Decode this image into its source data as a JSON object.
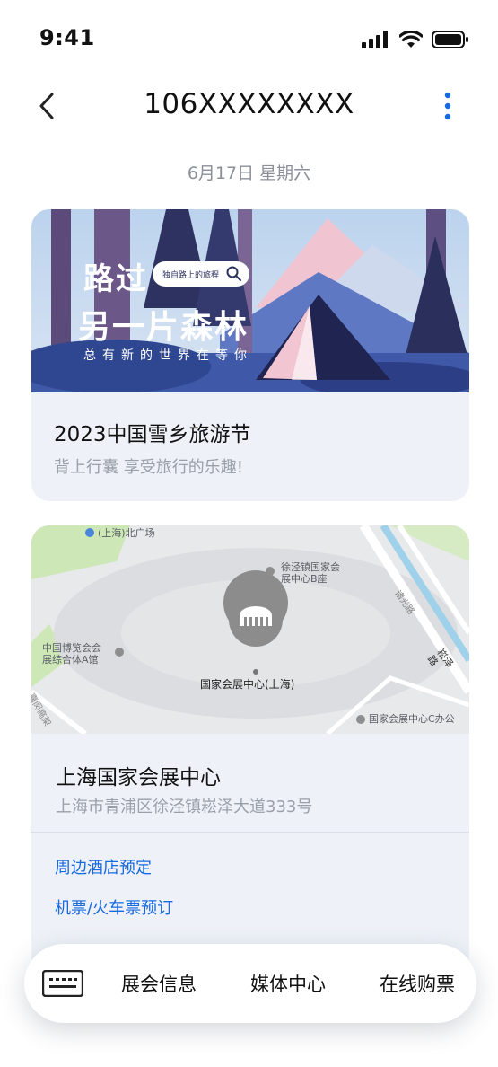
{
  "status_bar": {
    "time": "9:41"
  },
  "nav": {
    "title": "106XXXXXXXX"
  },
  "date": "6月17日  星期六",
  "card1": {
    "banner_title_line1": "路过",
    "banner_title_line2": "另一片森林",
    "banner_subtitle": "总有新的世界在等你",
    "banner_search": "独自路上的旅程",
    "title": "2023中国雪乡旅游节",
    "subtitle": "背上行囊 享受旅行的乐趣!"
  },
  "card2": {
    "map_labels": {
      "top": "(上海)北广场",
      "b_zone": "徐泾镇国家会\n展中心B座",
      "museum": "中国博览会会\n展综合体A馆",
      "center": "国家会展中心(上海)",
      "c_office": "国家会展中心C办公",
      "road1": "崧泽路",
      "road2": "诸光路",
      "road3": "嘉闵高架"
    },
    "title": "上海国家会展中心",
    "address": "上海市青浦区徐泾镇崧泽大道333号",
    "links": [
      "周边酒店预定",
      "机票/火车票预订"
    ]
  },
  "bottom_bar": {
    "items": [
      "展会信息",
      "媒体中心",
      "在线购票"
    ]
  },
  "colors": {
    "link": "#1769e0",
    "card_bg": "#eef2f8",
    "accent_more": "#1769e0"
  }
}
